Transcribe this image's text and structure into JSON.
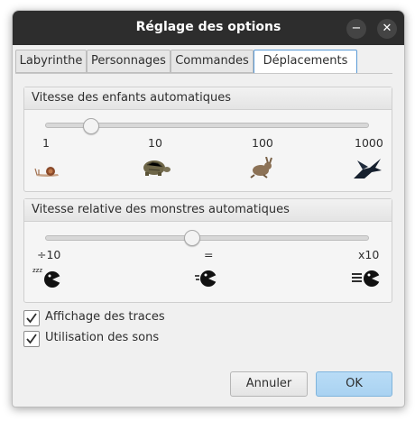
{
  "window": {
    "title": "Réglage des options",
    "minimize_glyph": "−",
    "close_glyph": "✕"
  },
  "tabs": [
    {
      "label": "Labyrinthe",
      "active": false
    },
    {
      "label": "Personnages",
      "active": false
    },
    {
      "label": "Commandes",
      "active": false
    },
    {
      "label": "Déplacements",
      "active": true
    }
  ],
  "children_speed": {
    "header": "Vitesse des enfants automatiques",
    "ticks": [
      "1",
      "10",
      "100",
      "1000"
    ],
    "value": 3,
    "icons": [
      "snail-icon",
      "turtle-icon",
      "hare-icon",
      "bird-icon"
    ]
  },
  "monster_speed": {
    "header": "Vitesse relative des monstres automatiques",
    "ticks": [
      "÷10",
      "=",
      "x10"
    ],
    "value": 1,
    "icons": [
      "sleeping-monster-icon",
      "monster-icon",
      "fast-monster-icon"
    ],
    "sleep_text": "zzz"
  },
  "options": [
    {
      "label": "Affichage des traces",
      "checked": true
    },
    {
      "label": "Utilisation des sons",
      "checked": true
    }
  ],
  "buttons": {
    "cancel": "Annuler",
    "ok": "OK"
  },
  "colors": {
    "titlebar": "#2d2d2d",
    "active_tab_border": "#5a9ad6",
    "ok_button": "#a9d2f1"
  }
}
